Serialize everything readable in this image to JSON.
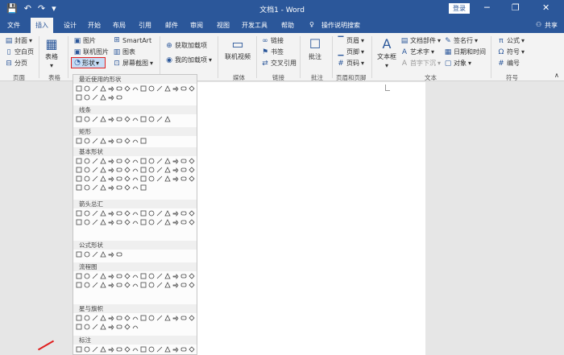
{
  "title": "文档1 - Word",
  "login": "登录",
  "share": "共享",
  "tabs": [
    "文件",
    "插入",
    "设计",
    "开始",
    "布局",
    "引用",
    "邮件",
    "审阅",
    "视图",
    "开发工具",
    "帮助",
    "操作说明搜索"
  ],
  "ribbon": {
    "cover": "封面",
    "blank_page": "空白页",
    "page_break": "分页",
    "group_pages": "页面",
    "table": "表格",
    "group_table": "表格",
    "picture": "图片",
    "online_picture": "联机图片",
    "shapes": "形状",
    "smartart": "SmartArt",
    "chart": "图表",
    "screenshot": "屏幕截图",
    "get_addins": "获取加载项",
    "my_addins": "我的加载项",
    "online_video": "联机视频",
    "group_media": "媒体",
    "link": "链接",
    "bookmark": "书签",
    "cross_ref": "交叉引用",
    "group_links": "链接",
    "comment": "批注",
    "group_comments": "批注",
    "header": "页眉",
    "footer": "页脚",
    "page_number": "页码",
    "group_header_footer": "页眉和页脚",
    "textbox": "文本框",
    "doc_parts": "文档部件",
    "wordart": "艺术字",
    "dropcap": "首字下沉",
    "signature": "签名行",
    "datetime": "日期和时间",
    "object": "对象",
    "group_text": "文本",
    "equation": "公式",
    "symbol": "符号",
    "numbering": "编号",
    "group_symbols": "符号"
  },
  "shapes_menu": {
    "sections": [
      "最近使用的形状",
      "线条",
      "矩形",
      "基本形状",
      "箭头总汇",
      "公式形状",
      "流程图",
      "星与旗帜",
      "标注"
    ]
  },
  "colors": {
    "brand": "#2b579a",
    "highlight_border": "#e02020"
  },
  "icons": [
    "save-icon",
    "undo-icon",
    "redo-icon",
    "customize-qat-icon",
    "lightbulb-icon",
    "user-icon",
    "minimize-icon",
    "restore-icon",
    "close-icon"
  ]
}
